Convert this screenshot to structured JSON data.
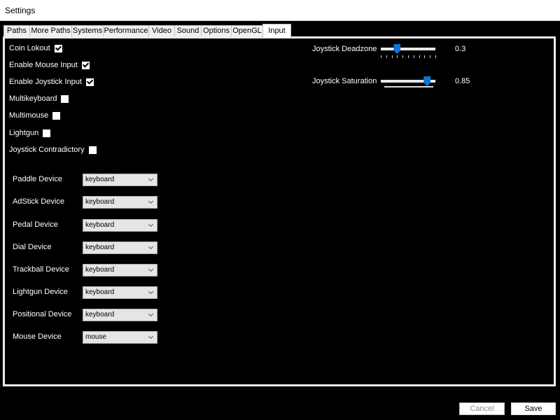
{
  "window": {
    "title": "Settings"
  },
  "tabs": [
    {
      "label": "Paths"
    },
    {
      "label": "More Paths"
    },
    {
      "label": "Systems"
    },
    {
      "label": "Performance"
    },
    {
      "label": "Video"
    },
    {
      "label": "Sound"
    },
    {
      "label": "Options"
    },
    {
      "label": "OpenGL"
    },
    {
      "label": "Input",
      "active": true
    }
  ],
  "checkboxes": [
    {
      "label": "Coin Lokout",
      "checked": true
    },
    {
      "label": "Enable Mouse Input",
      "checked": true
    },
    {
      "label": "Enable Joystick Input",
      "checked": true
    },
    {
      "label": "Multikeyboard",
      "checked": false
    },
    {
      "label": "Multimouse",
      "checked": false
    },
    {
      "label": "Lightgun",
      "checked": false
    },
    {
      "label": "Joystick Contradictory",
      "checked": false
    }
  ],
  "devices": [
    {
      "label": "Paddle Device",
      "value": "keyboard"
    },
    {
      "label": "AdStick Device",
      "value": "keyboard"
    },
    {
      "label": "Pedal Device",
      "value": "keyboard"
    },
    {
      "label": "Dial Device",
      "value": "keyboard"
    },
    {
      "label": "Trackball Device",
      "value": "keyboard"
    },
    {
      "label": "Lightgun Device",
      "value": "keyboard"
    },
    {
      "label": "Positional Device",
      "value": "keyboard"
    },
    {
      "label": "Mouse Device",
      "value": "mouse"
    }
  ],
  "sliders": {
    "deadzone": {
      "label": "Joystick Deadzone",
      "value": "0.3",
      "position": 0.3
    },
    "saturation": {
      "label": "Joystick Saturation",
      "value": "0.85",
      "position": 0.85
    }
  },
  "buttons": {
    "cancel": "Cancel",
    "save": "Save"
  },
  "colors": {
    "accent": "#0b74d8",
    "background": "#000000",
    "panel_border": "#ececec"
  }
}
